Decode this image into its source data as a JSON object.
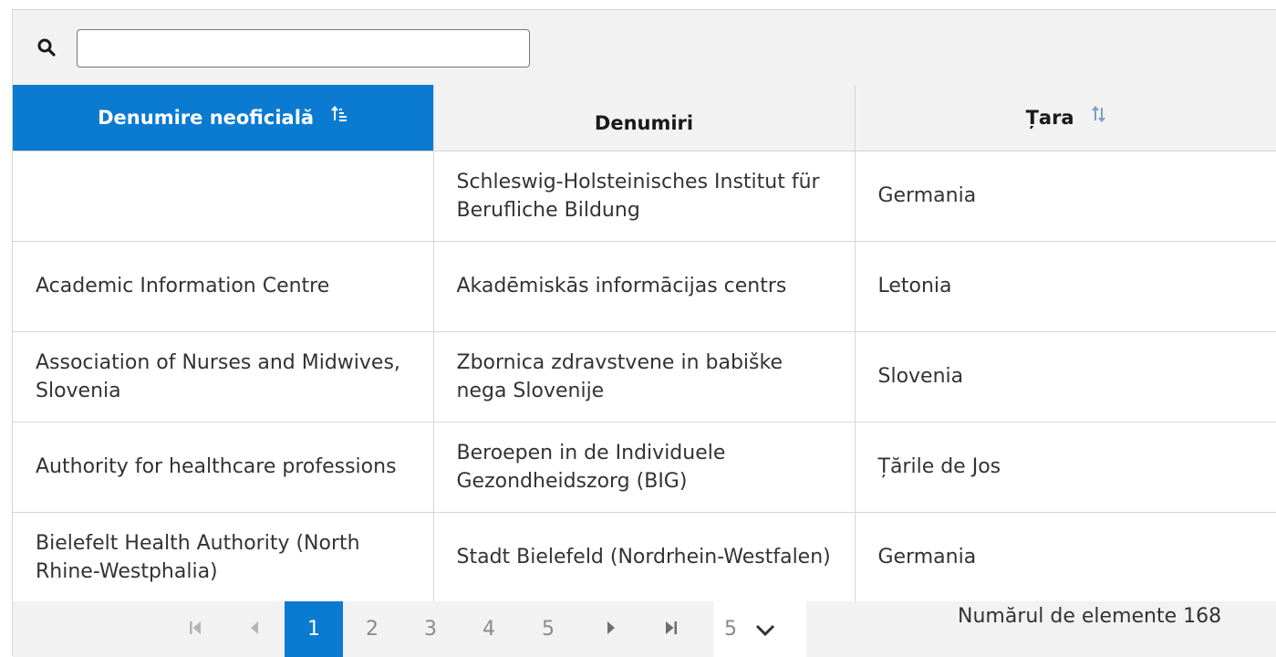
{
  "search": {
    "value": "",
    "placeholder": ""
  },
  "table": {
    "columns": [
      {
        "label": "Denumire neoficială",
        "sort": "ascending",
        "active": true
      },
      {
        "label": "Denumiri",
        "sort": "none",
        "active": false
      },
      {
        "label": "Țara",
        "sort": "both",
        "active": false
      }
    ],
    "rows": [
      [
        "",
        "Schleswig-Holsteinisches Institut für Berufliche Bildung",
        "Germania"
      ],
      [
        "Academic Information Centre",
        "Akadēmiskās informācijas centrs",
        "Letonia"
      ],
      [
        "Association of Nurses and Midwives, Slovenia",
        "Zbornica zdravstvene in babiške nega Slovenije",
        "Slovenia"
      ],
      [
        "Authority for healthcare professions",
        "Beroepen in de Individuele Gezondheidszorg (BIG)",
        "Țările de Jos"
      ],
      [
        "Bielefelt Health Authority (North Rhine-Westphalia)",
        "Stadt Bielefeld (Nordrhein-Westfalen)",
        "Germania"
      ]
    ]
  },
  "pager": {
    "first_icon": "first-page-icon",
    "prev_icon": "previous-page-icon",
    "next_icon": "next-page-icon",
    "last_icon": "last-page-icon",
    "pages": [
      "1",
      "2",
      "3",
      "4",
      "5"
    ],
    "current_page": "1",
    "page_size": "5",
    "page_size_icon": "chevron-down-icon",
    "count_text": "Numărul de elemente 168"
  },
  "colors": {
    "accent": "#0b7ad1",
    "header_bg": "#f2f2f2",
    "border": "#d6d6d6"
  }
}
